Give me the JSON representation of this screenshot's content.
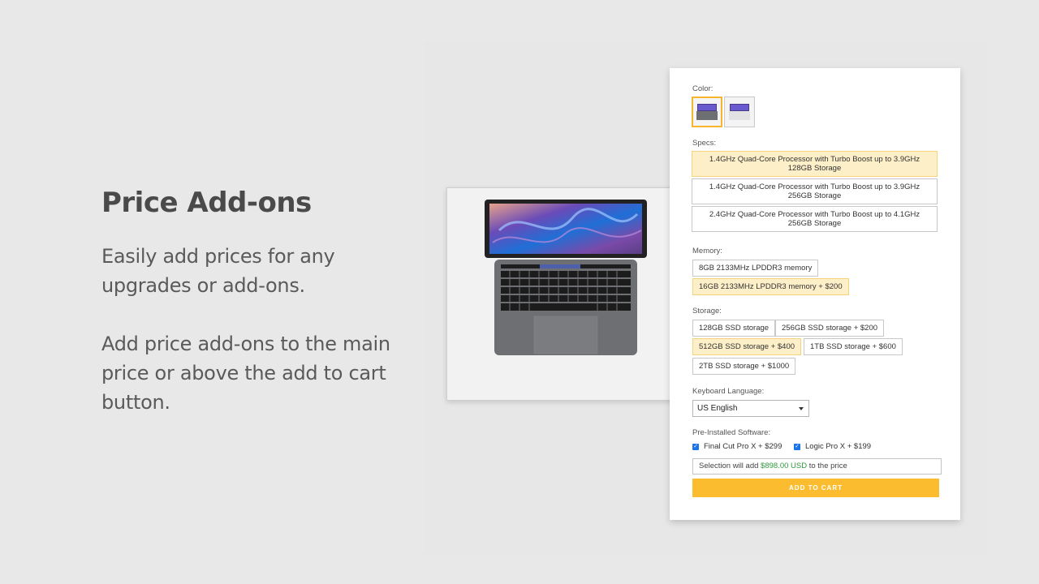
{
  "hero": {
    "title": "Price Add-ons",
    "paragraph_1": "Easily add prices for any upgrades or add-ons.",
    "paragraph_2": "Add price add-ons to the main price or above the add to cart button."
  },
  "product_image": {
    "icon": "laptop-image"
  },
  "options": {
    "color": {
      "label": "Color:",
      "swatches": [
        {
          "name": "Space Gray",
          "selected": true
        },
        {
          "name": "Silver",
          "selected": false
        }
      ]
    },
    "specs": {
      "label": "Specs:",
      "items": [
        {
          "line1": "1.4GHz Quad-Core Processor with Turbo Boost up to 3.9GHz",
          "line2": "128GB Storage",
          "selected": true
        },
        {
          "line1": "1.4GHz Quad-Core Processor with Turbo Boost up to 3.9GHz",
          "line2": "256GB Storage",
          "selected": false
        },
        {
          "line1": "2.4GHz Quad-Core Processor with Turbo Boost up to 4.1GHz",
          "line2": "256GB Storage",
          "selected": false
        }
      ]
    },
    "memory": {
      "label": "Memory:",
      "items": [
        {
          "label": "8GB 2133MHz LPDDR3 memory",
          "selected": false
        },
        {
          "label": "16GB 2133MHz LPDDR3 memory + $200",
          "selected": true
        }
      ]
    },
    "storage": {
      "label": "Storage:",
      "items": [
        {
          "label": "128GB SSD storage",
          "selected": false
        },
        {
          "label": "256GB SSD storage + $200",
          "selected": false
        },
        {
          "label": "512GB SSD storage + $400",
          "selected": true
        },
        {
          "label": "1TB SSD storage + $600",
          "selected": false
        },
        {
          "label": "2TB SSD storage + $1000",
          "selected": false
        }
      ]
    },
    "keyboard": {
      "label": "Keyboard Language:",
      "selected": "US English"
    },
    "software": {
      "label": "Pre-Installed Software:",
      "items": [
        {
          "label": "Final Cut Pro X + $299",
          "checked": true
        },
        {
          "label": "Logic Pro X + $199",
          "checked": true
        }
      ]
    },
    "summary": {
      "prefix": "Selection will add ",
      "amount": "$898.00 USD",
      "suffix": " to the price"
    },
    "add_to_cart_label": "ADD TO CART"
  },
  "colors": {
    "accent": "#fbbd2f",
    "selected_bg": "#fdefc8",
    "price_green": "#2e9a3a"
  }
}
